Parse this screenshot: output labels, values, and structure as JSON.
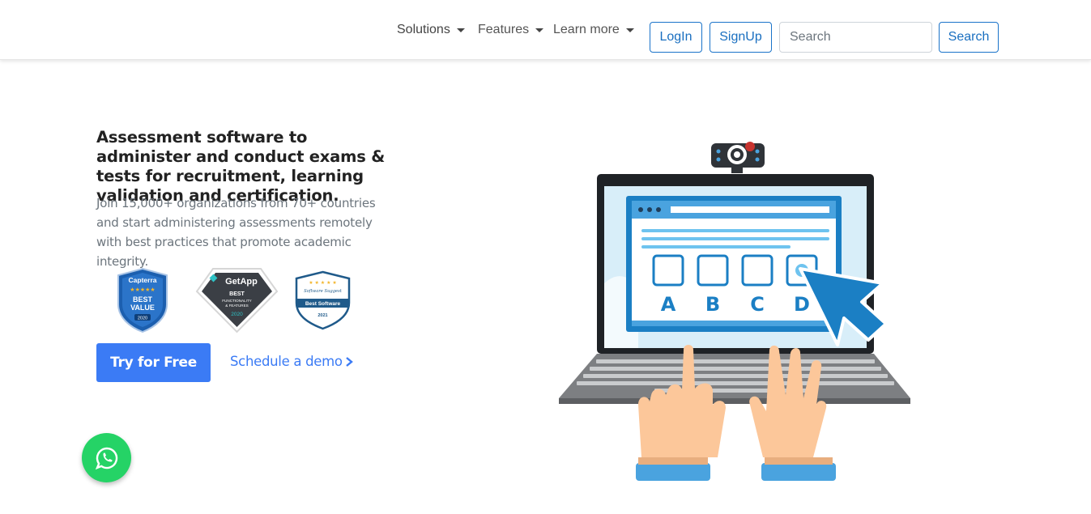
{
  "nav": {
    "solutions": "Solutions",
    "features": "Features",
    "learn_more": "Learn more",
    "login": "LogIn",
    "signup": "SignUp",
    "search_placeholder": "Search",
    "search_button": "Search"
  },
  "hero": {
    "title": "Assessment software to administer and conduct exams & tests for recruitment, learning validation and certification.",
    "subtitle": "Join 15,000+ organizations from 70+ countries and start administering assessments remotely with best practices that promote academic integrity.",
    "try_free": "Try for Free",
    "schedule_demo": "Schedule a demo"
  },
  "badges": {
    "capterra": {
      "brand": "Capterra",
      "line1": "BEST",
      "line2": "VALUE",
      "year": "2020"
    },
    "getapp": {
      "brand": "GetApp",
      "line1": "BEST",
      "line2": "FUNCTIONALITY",
      "line3": "& FEATURES",
      "year": "2020"
    },
    "software_suggest": {
      "brand": "Software Suggest",
      "label": "Best Software",
      "year": "2021"
    }
  },
  "illustration": {
    "options": [
      "A",
      "B",
      "C",
      "D"
    ]
  },
  "colors": {
    "primary": "#3b7bf5",
    "outline": "#1a6fc0",
    "whatsapp": "#25d366"
  },
  "icons": {
    "caret": "chevron-down-icon",
    "demo_arrow": "chevron-right-icon",
    "chat": "whatsapp-icon"
  }
}
